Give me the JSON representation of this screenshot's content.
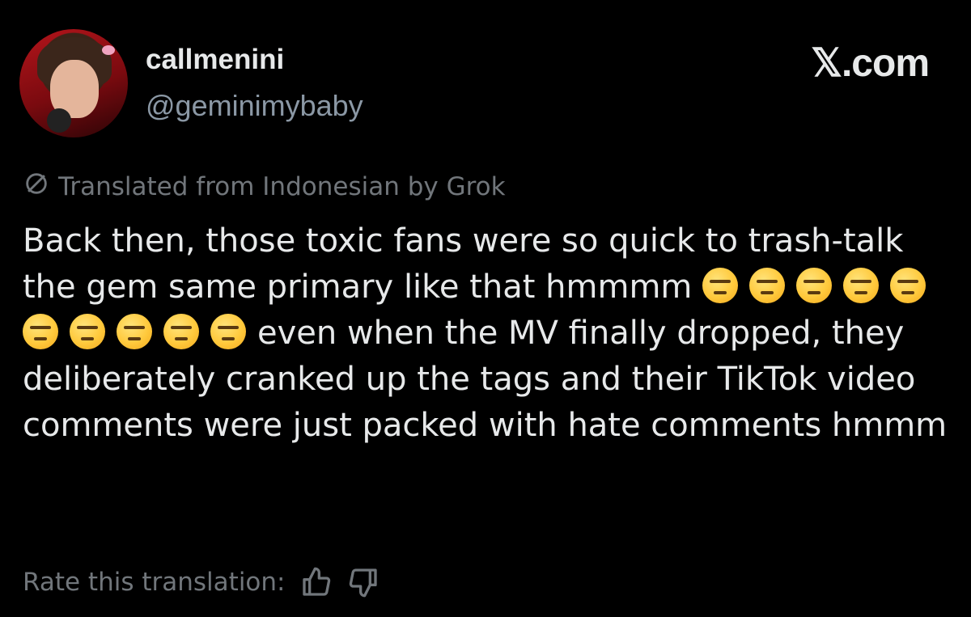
{
  "author": {
    "display_name": "callmenini",
    "handle": "@geminimybaby"
  },
  "brand": "𝕏.com",
  "translation": {
    "notice": "Translated from Indonesian by Grok",
    "rate_label": "Rate this translation:"
  },
  "post": {
    "text_part1": "Back then, those toxic fans were so quick to trash-talk the gem same primary like that hmmmm ",
    "emoji_count": 10,
    "emoji_name": "expressionless-face",
    "text_part2": "even when the MV finally dropped, they deliberately cranked up the tags and their TikTok video comments were just packed with hate comments hmmm"
  },
  "colors": {
    "background": "#000000",
    "primary_text": "#e7e9ea",
    "secondary_text": "#71767b"
  }
}
